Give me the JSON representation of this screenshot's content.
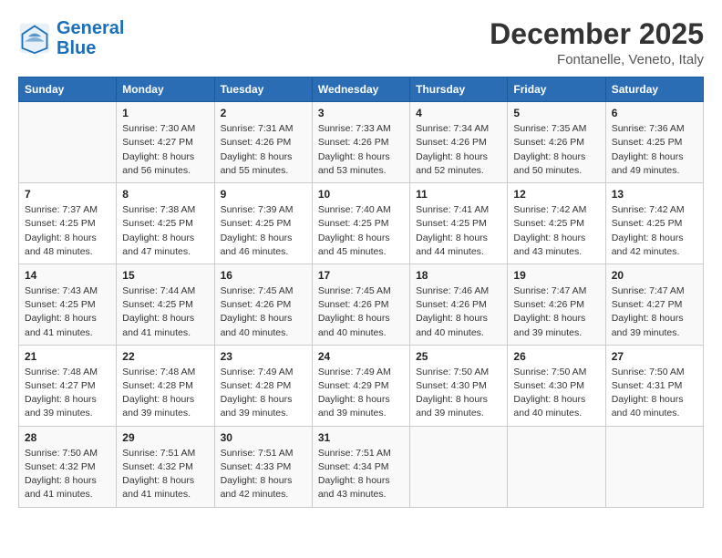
{
  "logo": {
    "line1": "General",
    "line2": "Blue"
  },
  "title": "December 2025",
  "subtitle": "Fontanelle, Veneto, Italy",
  "header_days": [
    "Sunday",
    "Monday",
    "Tuesday",
    "Wednesday",
    "Thursday",
    "Friday",
    "Saturday"
  ],
  "weeks": [
    [
      {
        "day": "",
        "info": ""
      },
      {
        "day": "1",
        "info": "Sunrise: 7:30 AM\nSunset: 4:27 PM\nDaylight: 8 hours\nand 56 minutes."
      },
      {
        "day": "2",
        "info": "Sunrise: 7:31 AM\nSunset: 4:26 PM\nDaylight: 8 hours\nand 55 minutes."
      },
      {
        "day": "3",
        "info": "Sunrise: 7:33 AM\nSunset: 4:26 PM\nDaylight: 8 hours\nand 53 minutes."
      },
      {
        "day": "4",
        "info": "Sunrise: 7:34 AM\nSunset: 4:26 PM\nDaylight: 8 hours\nand 52 minutes."
      },
      {
        "day": "5",
        "info": "Sunrise: 7:35 AM\nSunset: 4:26 PM\nDaylight: 8 hours\nand 50 minutes."
      },
      {
        "day": "6",
        "info": "Sunrise: 7:36 AM\nSunset: 4:25 PM\nDaylight: 8 hours\nand 49 minutes."
      }
    ],
    [
      {
        "day": "7",
        "info": "Sunrise: 7:37 AM\nSunset: 4:25 PM\nDaylight: 8 hours\nand 48 minutes."
      },
      {
        "day": "8",
        "info": "Sunrise: 7:38 AM\nSunset: 4:25 PM\nDaylight: 8 hours\nand 47 minutes."
      },
      {
        "day": "9",
        "info": "Sunrise: 7:39 AM\nSunset: 4:25 PM\nDaylight: 8 hours\nand 46 minutes."
      },
      {
        "day": "10",
        "info": "Sunrise: 7:40 AM\nSunset: 4:25 PM\nDaylight: 8 hours\nand 45 minutes."
      },
      {
        "day": "11",
        "info": "Sunrise: 7:41 AM\nSunset: 4:25 PM\nDaylight: 8 hours\nand 44 minutes."
      },
      {
        "day": "12",
        "info": "Sunrise: 7:42 AM\nSunset: 4:25 PM\nDaylight: 8 hours\nand 43 minutes."
      },
      {
        "day": "13",
        "info": "Sunrise: 7:42 AM\nSunset: 4:25 PM\nDaylight: 8 hours\nand 42 minutes."
      }
    ],
    [
      {
        "day": "14",
        "info": "Sunrise: 7:43 AM\nSunset: 4:25 PM\nDaylight: 8 hours\nand 41 minutes."
      },
      {
        "day": "15",
        "info": "Sunrise: 7:44 AM\nSunset: 4:25 PM\nDaylight: 8 hours\nand 41 minutes."
      },
      {
        "day": "16",
        "info": "Sunrise: 7:45 AM\nSunset: 4:26 PM\nDaylight: 8 hours\nand 40 minutes."
      },
      {
        "day": "17",
        "info": "Sunrise: 7:45 AM\nSunset: 4:26 PM\nDaylight: 8 hours\nand 40 minutes."
      },
      {
        "day": "18",
        "info": "Sunrise: 7:46 AM\nSunset: 4:26 PM\nDaylight: 8 hours\nand 40 minutes."
      },
      {
        "day": "19",
        "info": "Sunrise: 7:47 AM\nSunset: 4:26 PM\nDaylight: 8 hours\nand 39 minutes."
      },
      {
        "day": "20",
        "info": "Sunrise: 7:47 AM\nSunset: 4:27 PM\nDaylight: 8 hours\nand 39 minutes."
      }
    ],
    [
      {
        "day": "21",
        "info": "Sunrise: 7:48 AM\nSunset: 4:27 PM\nDaylight: 8 hours\nand 39 minutes."
      },
      {
        "day": "22",
        "info": "Sunrise: 7:48 AM\nSunset: 4:28 PM\nDaylight: 8 hours\nand 39 minutes."
      },
      {
        "day": "23",
        "info": "Sunrise: 7:49 AM\nSunset: 4:28 PM\nDaylight: 8 hours\nand 39 minutes."
      },
      {
        "day": "24",
        "info": "Sunrise: 7:49 AM\nSunset: 4:29 PM\nDaylight: 8 hours\nand 39 minutes."
      },
      {
        "day": "25",
        "info": "Sunrise: 7:50 AM\nSunset: 4:30 PM\nDaylight: 8 hours\nand 39 minutes."
      },
      {
        "day": "26",
        "info": "Sunrise: 7:50 AM\nSunset: 4:30 PM\nDaylight: 8 hours\nand 40 minutes."
      },
      {
        "day": "27",
        "info": "Sunrise: 7:50 AM\nSunset: 4:31 PM\nDaylight: 8 hours\nand 40 minutes."
      }
    ],
    [
      {
        "day": "28",
        "info": "Sunrise: 7:50 AM\nSunset: 4:32 PM\nDaylight: 8 hours\nand 41 minutes."
      },
      {
        "day": "29",
        "info": "Sunrise: 7:51 AM\nSunset: 4:32 PM\nDaylight: 8 hours\nand 41 minutes."
      },
      {
        "day": "30",
        "info": "Sunrise: 7:51 AM\nSunset: 4:33 PM\nDaylight: 8 hours\nand 42 minutes."
      },
      {
        "day": "31",
        "info": "Sunrise: 7:51 AM\nSunset: 4:34 PM\nDaylight: 8 hours\nand 43 minutes."
      },
      {
        "day": "",
        "info": ""
      },
      {
        "day": "",
        "info": ""
      },
      {
        "day": "",
        "info": ""
      }
    ]
  ]
}
